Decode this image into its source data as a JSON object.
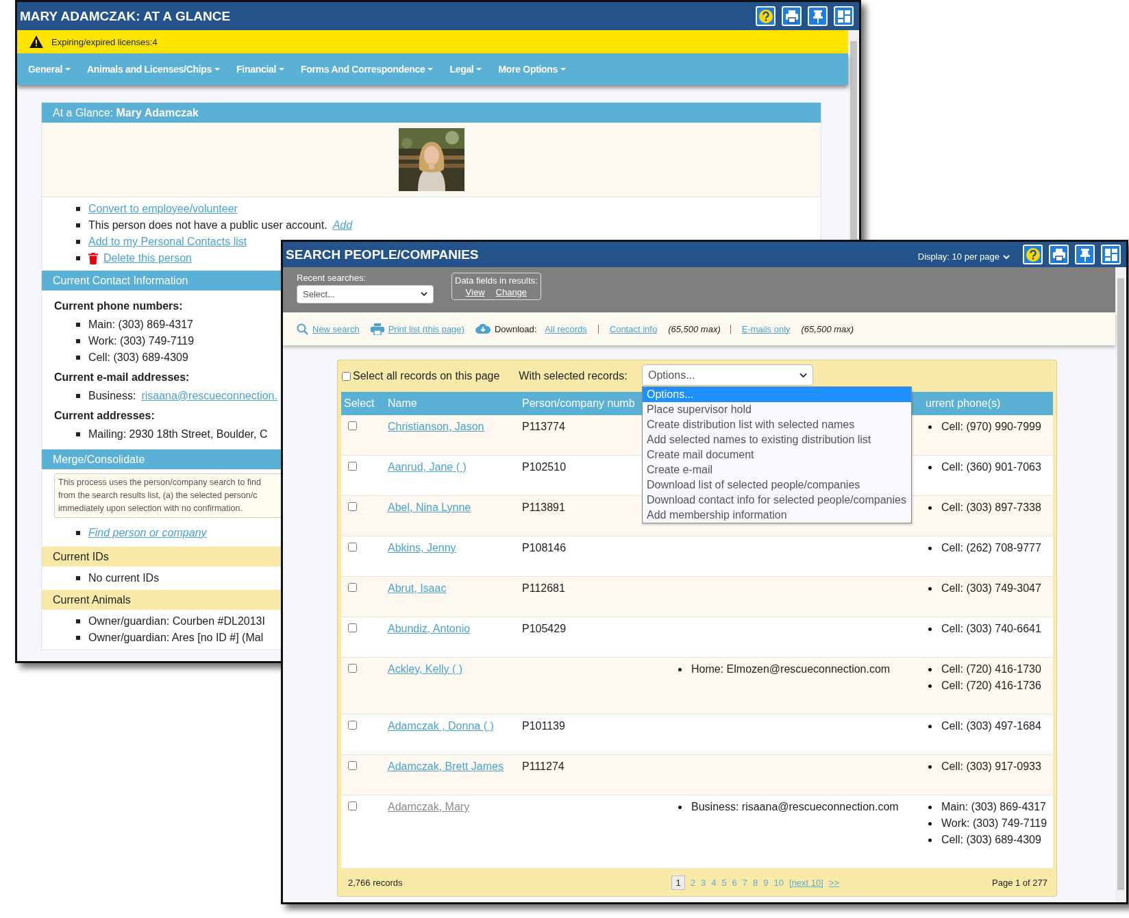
{
  "glance_window": {
    "title": "MARY ADAMCZAK: AT A GLANCE",
    "alert": "Expiring/expired licenses:4",
    "menu": [
      "General",
      "Animals and Licenses/Chips",
      "Financial",
      "Forms And Correspondence",
      "Legal",
      "More Options"
    ],
    "panel_title": "At a Glance: **Mary Adamczak**",
    "actions": [
      {
        "kind": "link",
        "text": "Convert to employee/volunteer"
      },
      {
        "kind": "note",
        "text": "This person does not have a public user account.",
        "link": "Add"
      },
      {
        "kind": "link",
        "text": "Add to my Personal Contacts list"
      },
      {
        "kind": "delete",
        "text": "Delete this person"
      }
    ],
    "sections": [
      {
        "kind": "contact",
        "title": "Current Contact Information",
        "groups": [
          {
            "heading": "Current phone numbers:",
            "items": [
              {
                "text": "Main: (303) 869-4317"
              },
              {
                "text": "Work: (303) 749-7119"
              },
              {
                "text": "Cell: (303) 689-4309"
              }
            ]
          },
          {
            "heading": "Current e-mail addresses:",
            "items": [
              {
                "text": "Business:",
                "link": "risaana@rescueconnection."
              }
            ]
          },
          {
            "heading": "Current addresses:",
            "items": [
              {
                "text": "Mailing: 2930 18th Street, Boulder, C"
              }
            ]
          }
        ]
      },
      {
        "kind": "merge",
        "title": "Merge/Consolidate",
        "note_lines": [
          "This process uses the person/company search to find",
          "from the search results list, (a) the selected person/c",
          "immediately upon selection with no confirmation."
        ],
        "link": "Find person or company"
      },
      {
        "kind": "list",
        "title": "Current IDs",
        "items": [
          "No current IDs"
        ]
      },
      {
        "kind": "list",
        "title": "Current Animals",
        "items": [
          "Owner/guardian: Courben #DL2013I",
          "Owner/guardian: Ares [no ID #] (Mal"
        ]
      }
    ]
  },
  "search_window": {
    "title": "SEARCH PEOPLE/COMPANIES",
    "display": "Display: 10 per page",
    "recent_label": "Recent searches:",
    "recent_value": "Select...",
    "fields_label": "Data fields in results:",
    "fields_links": [
      "View",
      "Change"
    ],
    "actions": [
      {
        "kind": "search",
        "text": "New search"
      },
      {
        "kind": "print",
        "text": "Print list (this page)"
      }
    ],
    "download": {
      "label": "Download:",
      "options": [
        {
          "text": "All records"
        },
        {
          "text": "Contact info",
          "note": "(65,500 max)"
        },
        {
          "text": "E-mails only",
          "note": "(65,500 max)"
        }
      ]
    },
    "select_all": {
      "label": "Select all records on this page",
      "checked": false
    },
    "bulk": {
      "label": "With selected records:",
      "value": "Options...",
      "options": [
        {
          "text": "Options...",
          "selected": true
        },
        {
          "text": "Place supervisor hold",
          "selected": false
        },
        {
          "text": "Create distribution list with selected names",
          "selected": false
        },
        {
          "text": "Add selected names to existing distribution list",
          "selected": false
        },
        {
          "text": "Create mail document",
          "selected": false
        },
        {
          "text": "Create e-mail",
          "selected": false
        },
        {
          "text": "Download list of selected people/companies",
          "selected": false
        },
        {
          "text": "Download contact info for selected people/companies",
          "selected": false
        },
        {
          "text": "Add membership information",
          "selected": false
        }
      ]
    },
    "columns": [
      "Select",
      "Name",
      "Person/company numb",
      "urrent phone(s)"
    ],
    "rows": [
      {
        "checked": false,
        "name": "Christianson, Jason",
        "visited": false,
        "number": "P113774",
        "phones": [
          "Cell: (970) 990-7999"
        ]
      },
      {
        "checked": false,
        "name": "Aanrud, Jane ( )",
        "visited": false,
        "number": "P102510",
        "phones": [
          "Cell: (360) 901-7063"
        ]
      },
      {
        "checked": false,
        "name": "Abel, Nina Lynne",
        "visited": false,
        "number": "P113891",
        "phones": [
          "Cell: (303) 897-7338"
        ]
      },
      {
        "checked": false,
        "name": "Abkins, Jenny",
        "visited": false,
        "number": "P108146",
        "phones": [
          "Cell: (262) 708-9777"
        ]
      },
      {
        "checked": false,
        "name": "Abrut, Isaac",
        "visited": false,
        "number": "P112681",
        "phones": [
          "Cell: (303) 749-3047"
        ]
      },
      {
        "checked": false,
        "name": "Abundiz, Antonio",
        "visited": false,
        "number": "P105429",
        "phones": [
          "Cell: (303) 740-6641"
        ]
      },
      {
        "checked": false,
        "name": "Ackley, Kelly ( )",
        "visited": false,
        "emails": [
          "Home: Elmozen@rescueconnection.com"
        ],
        "phones": [
          "Cell: (720) 416-1730",
          "Cell: (720) 416-1736"
        ]
      },
      {
        "checked": false,
        "name": "Adamczak , Donna ( )",
        "visited": false,
        "number": "P101139",
        "phones": [
          "Cell: (303) 497-1684"
        ]
      },
      {
        "checked": false,
        "name": "Adamczak, Brett James",
        "visited": false,
        "number": "P111274",
        "phones": [
          "Cell: (303) 917-0933"
        ]
      },
      {
        "checked": false,
        "name": "Adamczak, Mary",
        "visited": true,
        "emails": [
          "Business: risaana@rescueconnection.com"
        ],
        "phones": [
          "Main: (303) 869-4317",
          "Work: (303) 749-7119",
          "Cell: (303) 689-4309"
        ]
      }
    ],
    "footer": {
      "count": "2,766 records",
      "pages": [
        {
          "text": "1",
          "selected": true
        },
        {
          "text": "2",
          "selected": false
        },
        {
          "text": "3",
          "selected": false
        },
        {
          "text": "4",
          "selected": false
        },
        {
          "text": "5",
          "selected": false
        },
        {
          "text": "6",
          "selected": false
        },
        {
          "text": "7",
          "selected": false
        },
        {
          "text": "8",
          "selected": false
        },
        {
          "text": "9",
          "selected": false
        },
        {
          "text": "10",
          "selected": false
        }
      ],
      "next": "[next 10]",
      "last": ">>",
      "page_info": "Page 1 of 277"
    }
  }
}
